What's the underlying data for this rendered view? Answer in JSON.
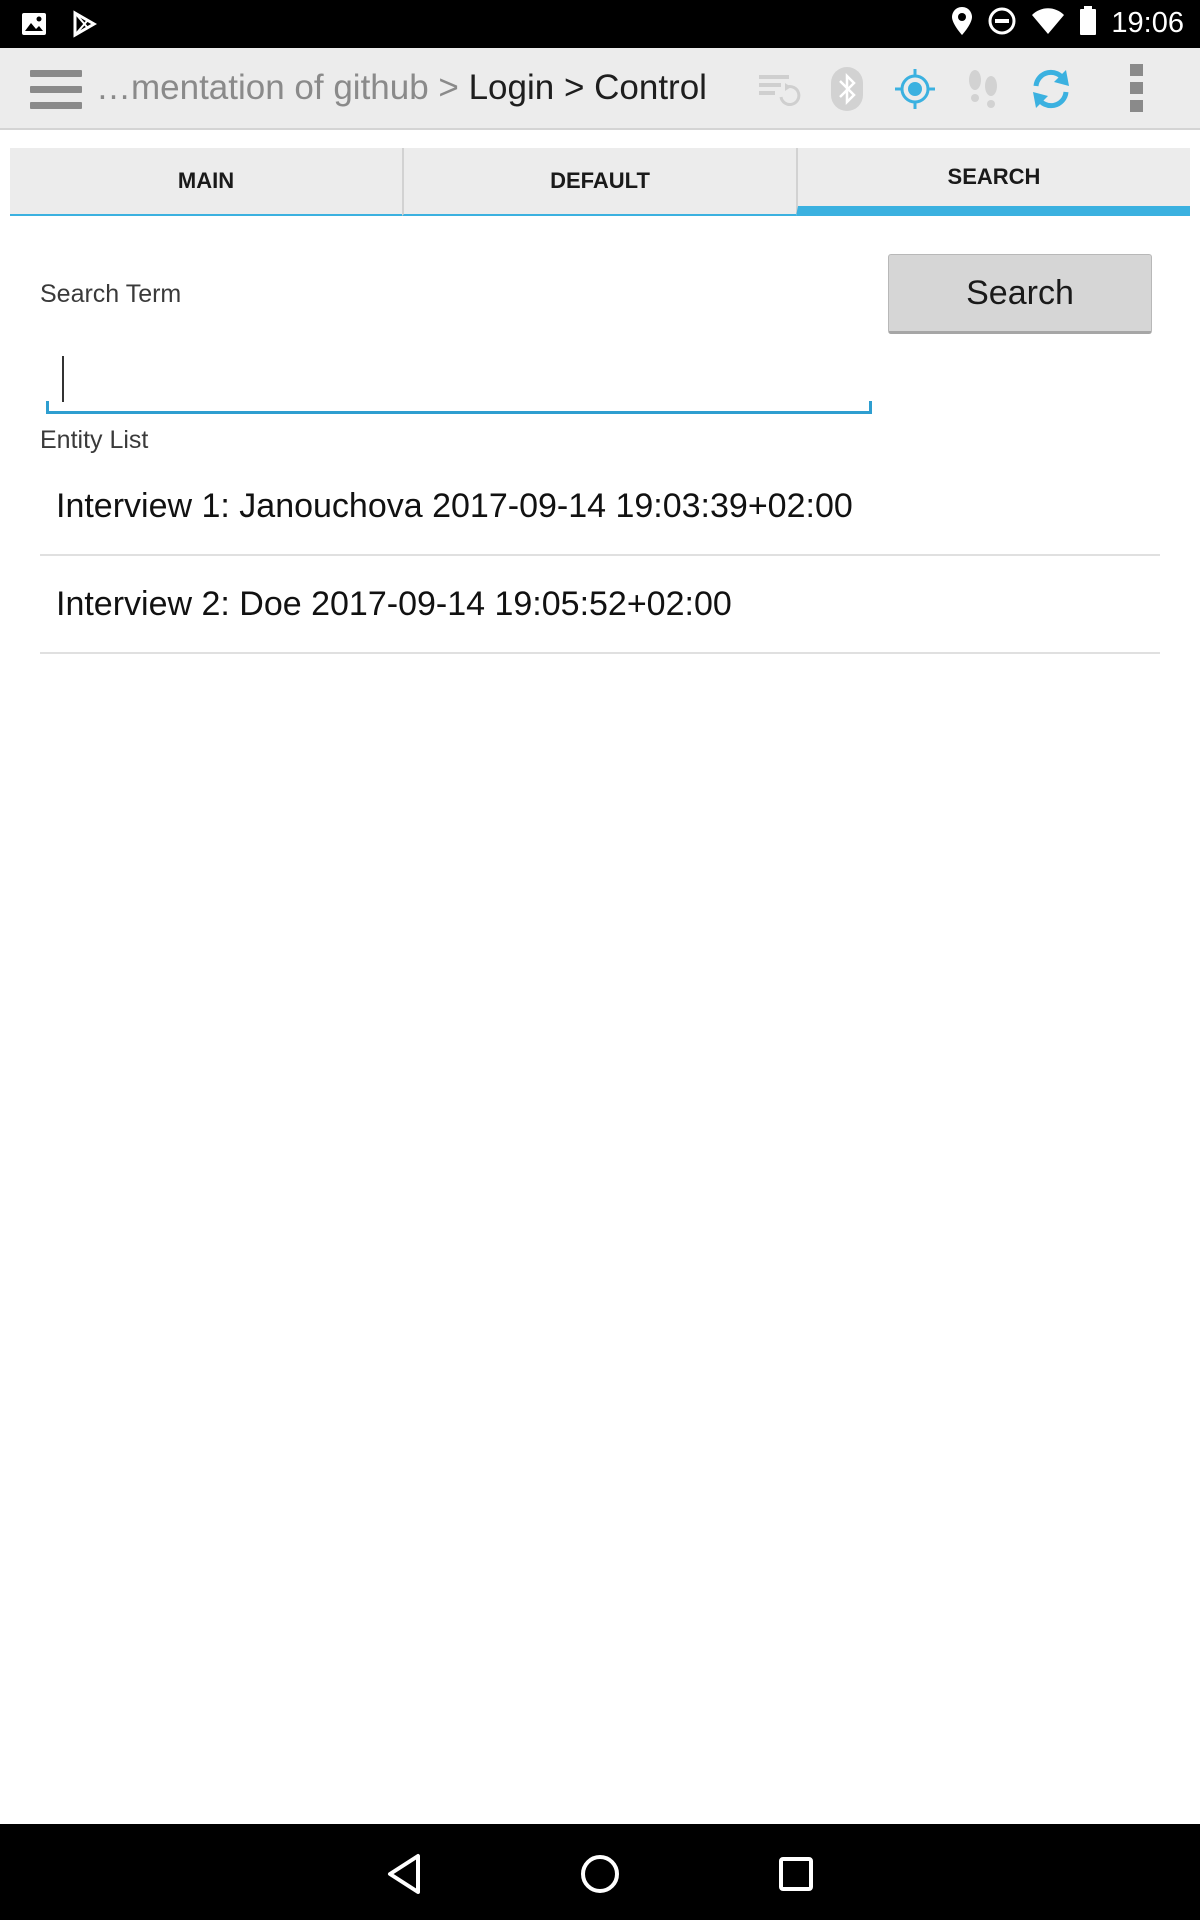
{
  "status_bar": {
    "time": "19:06",
    "left_icons": [
      "image-icon",
      "play-store-icon"
    ],
    "right_icons": [
      "location-icon",
      "do-not-disturb-icon",
      "wifi-icon",
      "battery-icon"
    ]
  },
  "action_bar": {
    "breadcrumb_dim": "…mentation of github > ",
    "breadcrumb_login": "Login",
    "breadcrumb_sep": " > ",
    "breadcrumb_current": "Control",
    "icons": [
      "sync-status-icon",
      "bluetooth-icon",
      "gps-icon",
      "footsteps-icon",
      "refresh-icon"
    ],
    "colors": {
      "active_blue": "#3bb1e0",
      "inactive_gray": "#b5b5b5"
    }
  },
  "tabs": [
    {
      "label": "MAIN",
      "active": false
    },
    {
      "label": "DEFAULT",
      "active": false
    },
    {
      "label": "SEARCH",
      "active": true
    }
  ],
  "search": {
    "label": "Search Term",
    "value": "",
    "placeholder": "",
    "button_label": "Search"
  },
  "entity_list": {
    "label": "Entity List",
    "items": [
      "Interview 1: Janouchova 2017-09-14 19:03:39+02:00",
      "Interview 2: Doe 2017-09-14 19:05:52+02:00"
    ]
  },
  "nav_bar": {
    "buttons": [
      "back-icon",
      "home-icon",
      "recents-icon"
    ]
  }
}
